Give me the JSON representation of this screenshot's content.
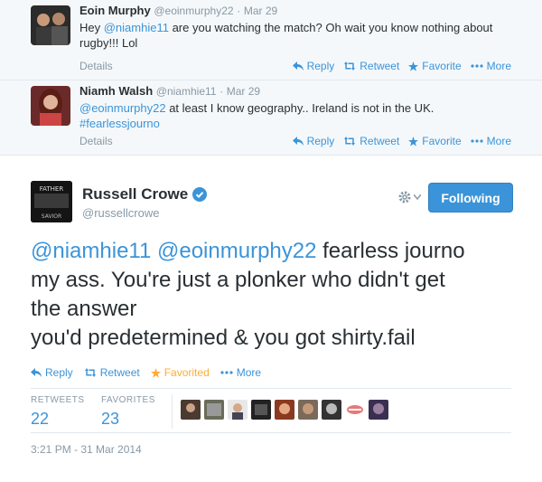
{
  "replies": [
    {
      "name": "Eoin Murphy",
      "handle": "@eoinmurphy22",
      "sep": "·",
      "date": "Mar 29",
      "text_pre": "Hey ",
      "mention": "@niamhie11",
      "text_post": " are you watching the match? Oh wait you know nothing about rugby!!! Lol",
      "details": "Details"
    },
    {
      "name": "Niamh Walsh",
      "handle": "@niamhie11",
      "sep": "·",
      "date": "Mar 29",
      "mention": "@eoinmurphy22",
      "text_post": " at least I know geography.. Ireland is not in the UK.",
      "hashtag": "#fearlessjourno",
      "details": "Details"
    }
  ],
  "actions": {
    "reply": "Reply",
    "retweet": "Retweet",
    "favorite": "Favorite",
    "favorited": "Favorited",
    "more": "More"
  },
  "main": {
    "name": "Russell Crowe",
    "handle": "@russellcrowe",
    "follow_label": "Following",
    "mention1": "@niamhie11",
    "mention2": "@eoinmurphy22",
    "text_line1_rest": " fearless journo",
    "text_line2": "my ass. You're just a plonker who didn't get",
    "text_line3": "the answer",
    "text_line4": "you'd predetermined & you got shirty.fail",
    "avatar_text_top": "FATHER",
    "avatar_text_bottom": "SAVIOR",
    "retweets_label": "RETWEETS",
    "retweets_value": "22",
    "favorites_label": "FAVORITES",
    "favorites_value": "23",
    "timestamp": "3:21 PM - 31 Mar 2014"
  },
  "colors": {
    "link": "#3b94d9",
    "muted": "#8899a6",
    "favorited": "#ffac33",
    "verified": "#3b94d9",
    "reply_bg": "#f5f8fa"
  },
  "icons": [
    "reply-icon",
    "retweet-icon",
    "star-icon",
    "more-dots-icon",
    "gear-icon",
    "verified-badge-icon"
  ]
}
